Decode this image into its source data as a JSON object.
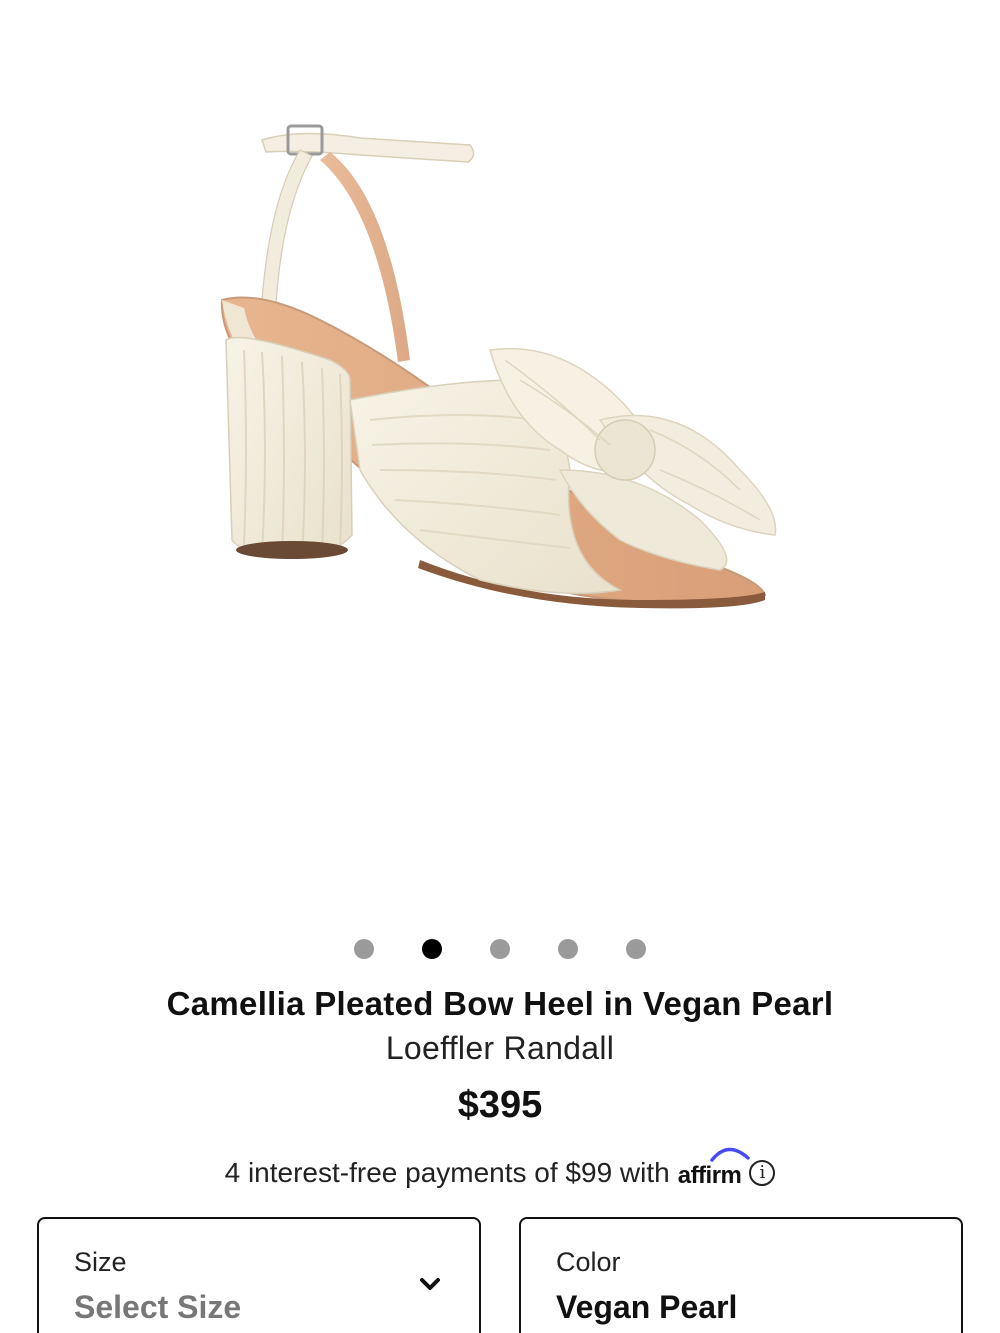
{
  "product": {
    "title": "Camellia Pleated Bow Heel in Vegan Pearl",
    "brand": "Loeffler Randall",
    "price": "$395",
    "image_alt": "Camellia Pleated Bow Heel sandal",
    "carousel": {
      "total": 5,
      "active_index": 1
    }
  },
  "payments": {
    "text": "4 interest-free payments of $99 with",
    "provider": "affirm",
    "info_icon": "info-icon"
  },
  "options": {
    "size": {
      "label": "Size",
      "value": "Select Size",
      "icon": "chevron-down-icon"
    },
    "color": {
      "label": "Color",
      "value": "Vegan Pearl"
    }
  },
  "colors": {
    "text": "#111111",
    "muted": "#777777",
    "dot_inactive": "#9a9a9a",
    "dot_active": "#000000",
    "affirm_arc": "#4a4af4"
  }
}
